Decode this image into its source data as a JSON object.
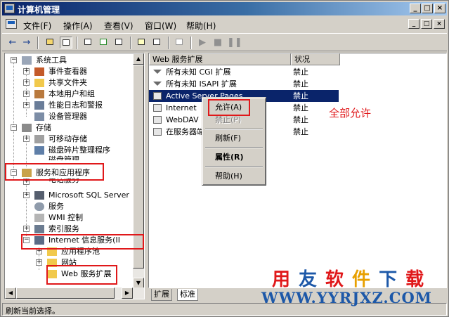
{
  "window": {
    "title": "计算机管理"
  },
  "caption_buttons": {
    "minimize": "_",
    "maximize": "□",
    "close": "×"
  },
  "menu": {
    "items": [
      "文件(F)",
      "操作(A)",
      "查看(V)",
      "窗口(W)",
      "帮助(H)"
    ]
  },
  "tree": {
    "system_tools": "系统工具",
    "event_viewer": "事件查看器",
    "shared_folders": "共享文件夹",
    "local_users": "本地用户和组",
    "perf_logs": "性能日志和警报",
    "device_manager": "设备管理器",
    "storage": "存储",
    "removable_storage": "可移动存储",
    "defrag": "磁盘碎片整理程序",
    "disk_mgmt": "磁盘管理",
    "services_apps": "服务和应用程序",
    "telephony": "电话服务",
    "sql_server": "Microsoft SQL Server",
    "services": "服务",
    "wmi": "WMI 控制",
    "indexing": "索引服务",
    "iis": "Internet 信息服务(II",
    "app_pools": "应用程序池",
    "websites": "网站",
    "web_ext": "Web 服务扩展"
  },
  "list": {
    "col_name": "Web 服务扩展",
    "col_status": "状况",
    "rows": [
      {
        "name": "所有未知 CGI 扩展",
        "status": "禁止"
      },
      {
        "name": "所有未知 ISAPI 扩展",
        "status": "禁止"
      },
      {
        "name": "Active Server Pages",
        "status": "禁止"
      },
      {
        "name": "Internet",
        "status": "禁止"
      },
      {
        "name": "WebDAV",
        "status": "禁止"
      },
      {
        "name": "在服务器端",
        "status": "禁止"
      }
    ]
  },
  "context_menu": {
    "allow": "允许(A)",
    "prohibit": "禁止(P)",
    "refresh": "刷新(F)",
    "properties": "属性(R)",
    "help": "帮助(H)"
  },
  "tabs": {
    "extended": "扩展",
    "standard": "标准"
  },
  "status_bar": "刷新当前选择。",
  "annotation": "全部允许",
  "watermark": {
    "chars": [
      "用",
      "友",
      "软",
      "件",
      "下",
      "载"
    ],
    "char_colors": [
      "#e0181a",
      "#1d58a8",
      "#e0181a",
      "#e8a000",
      "#1d58a8",
      "#e0181a"
    ],
    "url": "WWW.YYRJXZ.COM"
  },
  "colors": {
    "selection": "#0a246a",
    "annotation_red": "#e0181a"
  }
}
